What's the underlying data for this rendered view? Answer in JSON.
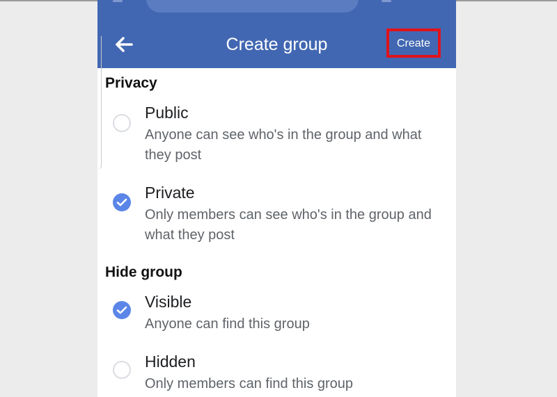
{
  "header": {
    "title": "Create group",
    "create_label": "Create"
  },
  "privacy": {
    "heading": "Privacy",
    "options": [
      {
        "title": "Public",
        "description": "Anyone can see who's in the group and what they post",
        "selected": false
      },
      {
        "title": "Private",
        "description": "Only members can see who's in the group and what they post",
        "selected": true
      }
    ]
  },
  "hide_group": {
    "heading": "Hide group",
    "options": [
      {
        "title": "Visible",
        "description": "Anyone can find this group",
        "selected": true
      },
      {
        "title": "Hidden",
        "description": "Only members can find this group",
        "selected": false
      }
    ]
  },
  "icons": {
    "back": "arrow-left-icon",
    "selected": "check-circle-icon",
    "unselected": "empty-circle-icon"
  },
  "colors": {
    "appbar": "#4267b2",
    "highlight_box": "#e0131a",
    "radio_selected": "#5b86e8"
  }
}
